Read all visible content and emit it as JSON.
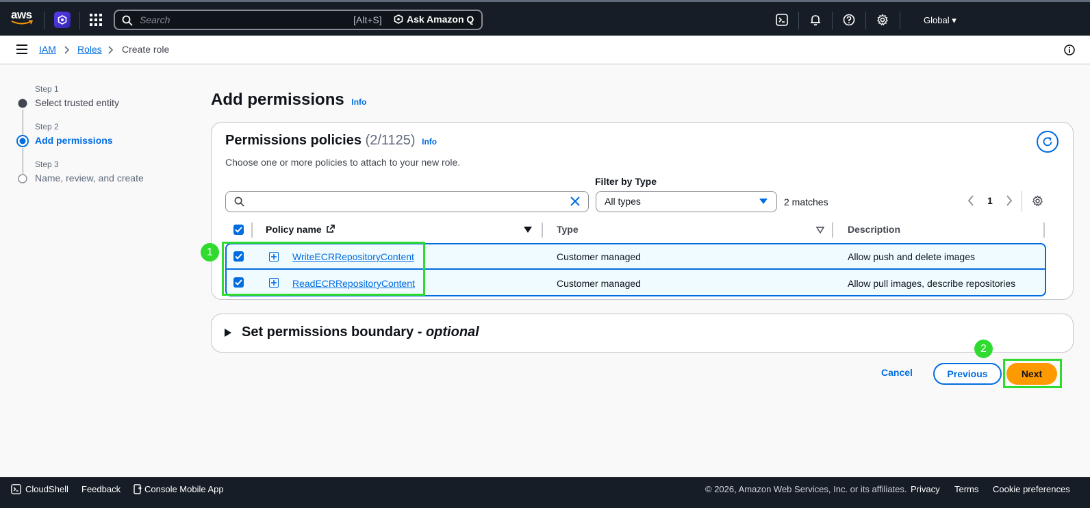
{
  "topnav": {
    "logo_text": "aws",
    "search_placeholder": "Search",
    "search_shortcut": "[Alt+S]",
    "ask_q_label": "Ask Amazon Q",
    "region_label": "Global"
  },
  "breadcrumb": {
    "items": [
      "IAM",
      "Roles",
      "Create role"
    ]
  },
  "wizard": {
    "steps": [
      {
        "label": "Step 1",
        "title": "Select trusted entity"
      },
      {
        "label": "Step 2",
        "title": "Add permissions"
      },
      {
        "label": "Step 3",
        "title": "Name, review, and create"
      }
    ]
  },
  "page": {
    "title": "Add permissions",
    "info_label": "Info"
  },
  "policies": {
    "title": "Permissions policies",
    "count": "(2/1125)",
    "info_label": "Info",
    "description": "Choose one or more policies to attach to your new role.",
    "filter_label": "Filter by Type",
    "filter_value": "All types",
    "matches": "2 matches",
    "page_number": "1",
    "columns": [
      "Policy name",
      "Type",
      "Description"
    ],
    "rows": [
      {
        "name": "WriteECRRepositoryContent",
        "type": "Customer managed",
        "description": "Allow push and delete images"
      },
      {
        "name": "ReadECRRepositoryContent",
        "type": "Customer managed",
        "description": "Allow pull images, describe repositories"
      }
    ]
  },
  "boundary": {
    "title": "Set permissions boundary - ",
    "title_italic": "optional"
  },
  "actions": {
    "cancel": "Cancel",
    "previous": "Previous",
    "next": "Next"
  },
  "annotations": {
    "badge_1": "1",
    "badge_2": "2",
    "highlight_color": "#2fdb2f"
  },
  "footer": {
    "cloudshell": "CloudShell",
    "feedback": "Feedback",
    "mobile_app": "Console Mobile App",
    "copyright": "© 2026, Amazon Web Services, Inc. or its affiliates.",
    "privacy": "Privacy",
    "terms": "Terms",
    "cookies": "Cookie preferences"
  },
  "colors": {
    "link": "#006ce0",
    "nav_bg": "#161d26",
    "primary_button": "#ff9900"
  }
}
